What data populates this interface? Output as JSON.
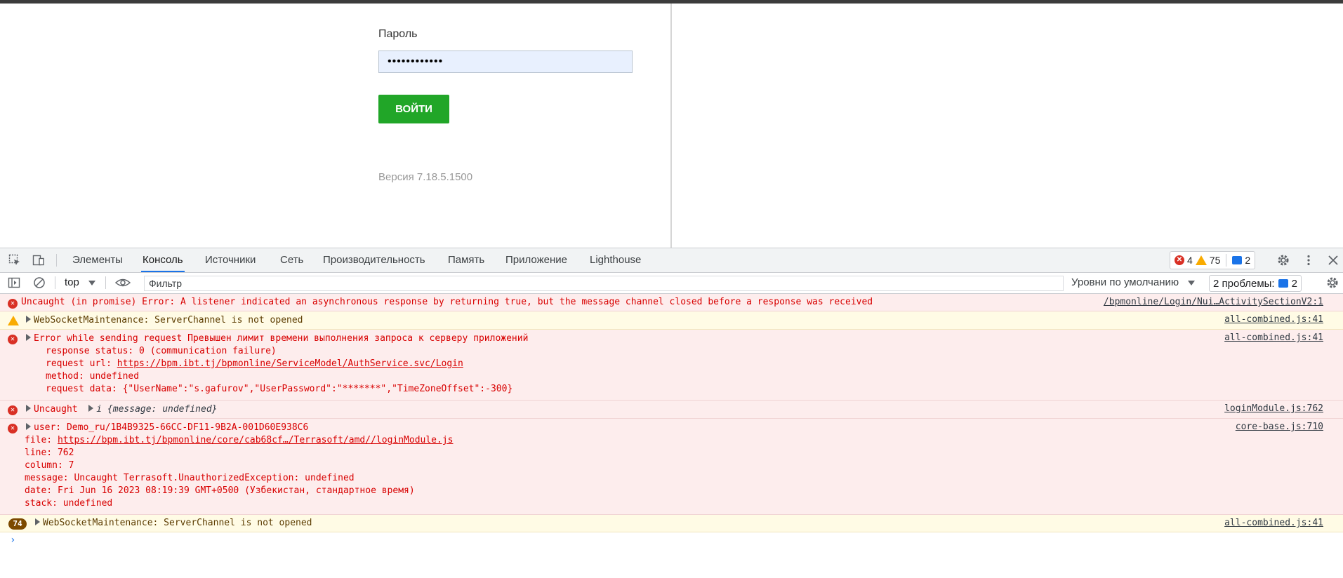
{
  "login": {
    "password_label": "Пароль",
    "password_value": "••••••••••••",
    "login_button": "ВОЙТИ",
    "version": "Версия 7.18.5.1500"
  },
  "devtools": {
    "tabs": [
      "Элементы",
      "Консоль",
      "Источники",
      "Сеть",
      "Производительность",
      "Память",
      "Приложение",
      "Lighthouse"
    ],
    "active_tab": "Консоль",
    "counters": {
      "errors": "4",
      "warnings": "75",
      "messages": "2"
    },
    "toolbar": {
      "context": "top",
      "filter_placeholder": "Фильтр",
      "levels": "Уровни по умолчанию",
      "issues_label": "2 проблемы:",
      "issues_count": "2"
    },
    "console": {
      "msg1": {
        "text": "Uncaught (in promise) Error: A listener indicated an asynchronous response by returning true, but the message channel closed before a response was received",
        "source": "/bpmonline/Login/Nui…ActivitySectionV2:1"
      },
      "msg2": {
        "text": "WebSocketMaintenance: ServerChannel is not opened",
        "source": "all-combined.js:41"
      },
      "msg3": {
        "line1": "Error while sending request Превышен лимит времени выполнения запроса к серверу приложений",
        "line2": "response status: 0 (communication failure)",
        "line3_prefix": "request url: ",
        "line3_url": "https://bpm.ibt.tj/bpmonline/ServiceModel/AuthService.svc/Login",
        "line4": "method: undefined",
        "line5": "request data: {\"UserName\":\"s.gafurov\",\"UserPassword\":\"*******\",\"TimeZoneOffset\":-300}",
        "source": "all-combined.js:41"
      },
      "msg4": {
        "prefix": "Uncaught",
        "object": "i {message: undefined}",
        "source": "loginModule.js:762"
      },
      "msg5": {
        "line1": "user: Demo_ru/1B4B9325-66CC-DF11-9B2A-001D60E938C6",
        "line2_prefix": "file: ",
        "line2_url": "https://bpm.ibt.tj/bpmonline/core/cab68cf…/Terrasoft/amd//loginModule.js",
        "line3": "line: 762",
        "line4": "column: 7",
        "line5": "message: Uncaught Terrasoft.UnauthorizedException: undefined",
        "line6": "date: Fri Jun 16 2023 08:19:39 GMT+0500 (Узбекистан, стандартное время)",
        "line7": "stack: undefined",
        "source": "core-base.js:710"
      },
      "msg6": {
        "count": "74",
        "text": "WebSocketMaintenance: ServerChannel is not opened",
        "source": "all-combined.js:41"
      }
    }
  }
}
